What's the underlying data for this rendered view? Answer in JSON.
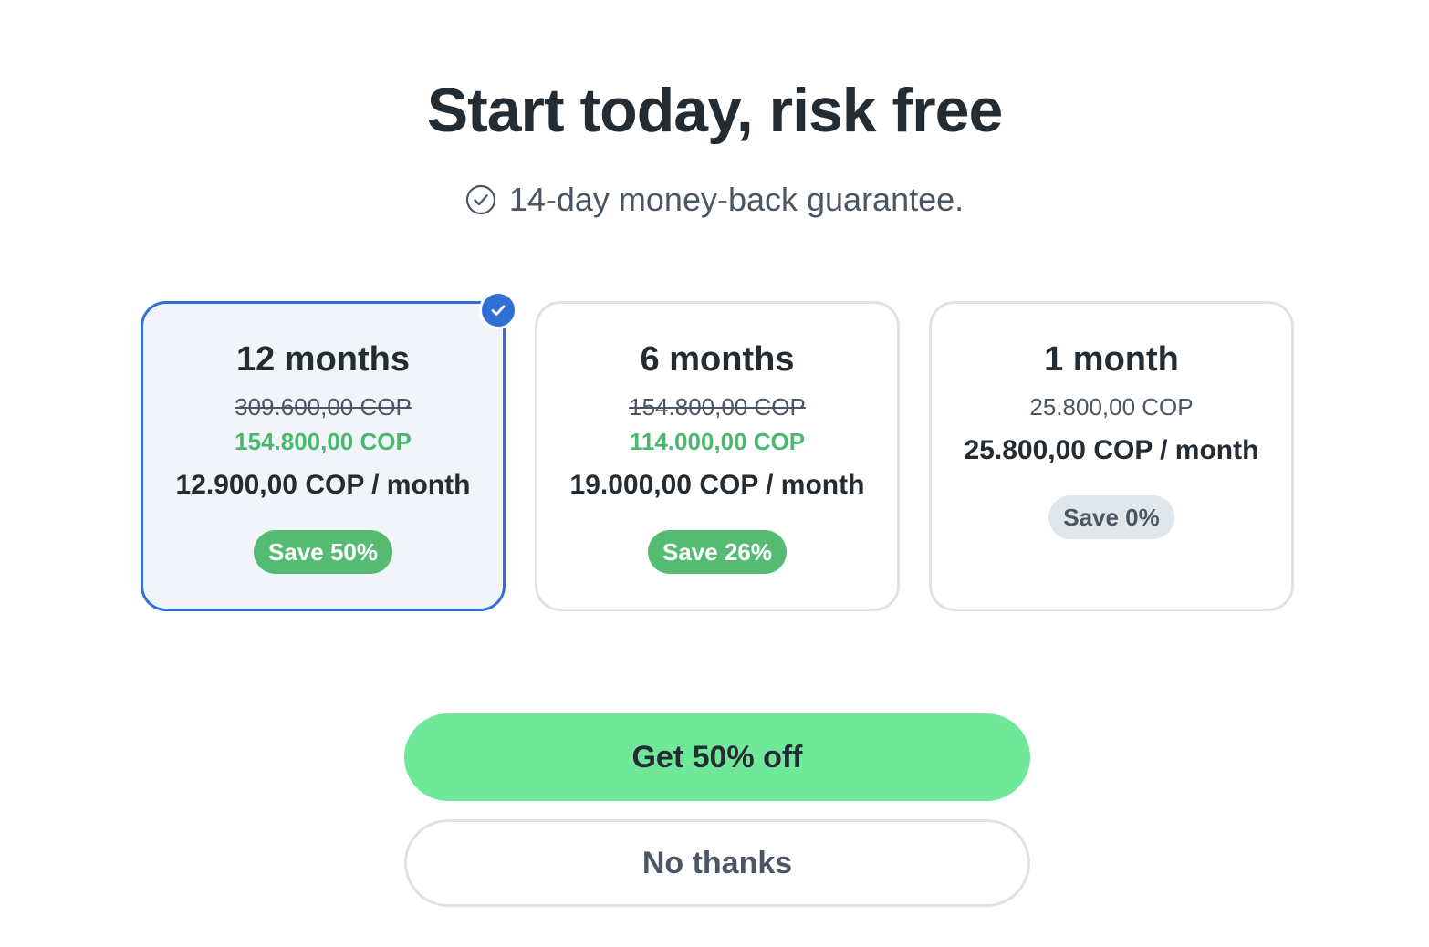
{
  "header": {
    "title": "Start today, risk free",
    "guarantee_text": "14-day money-back guarantee.",
    "guarantee_icon": "check-circle-icon"
  },
  "plans": [
    {
      "name": "12 months",
      "old_price": "309.600,00 COP",
      "new_price": "154.800,00 COP",
      "per_month": "12.900,00 COP / month",
      "save_label": "Save 50%",
      "selected": true
    },
    {
      "name": "6 months",
      "old_price": "154.800,00 COP",
      "new_price": "114.000,00 COP",
      "per_month": "19.000,00 COP / month",
      "save_label": "Save 26%",
      "selected": false
    },
    {
      "name": "1 month",
      "regular_price": "25.800,00 COP",
      "per_month": "25.800,00 COP / month",
      "save_label": "Save 0%",
      "selected": false
    }
  ],
  "actions": {
    "primary_label": "Get 50% off",
    "secondary_label": "No thanks"
  },
  "colors": {
    "accent_blue": "#2f6fd6",
    "savings_green": "#55bb73",
    "primary_button": "#6fe89a"
  }
}
